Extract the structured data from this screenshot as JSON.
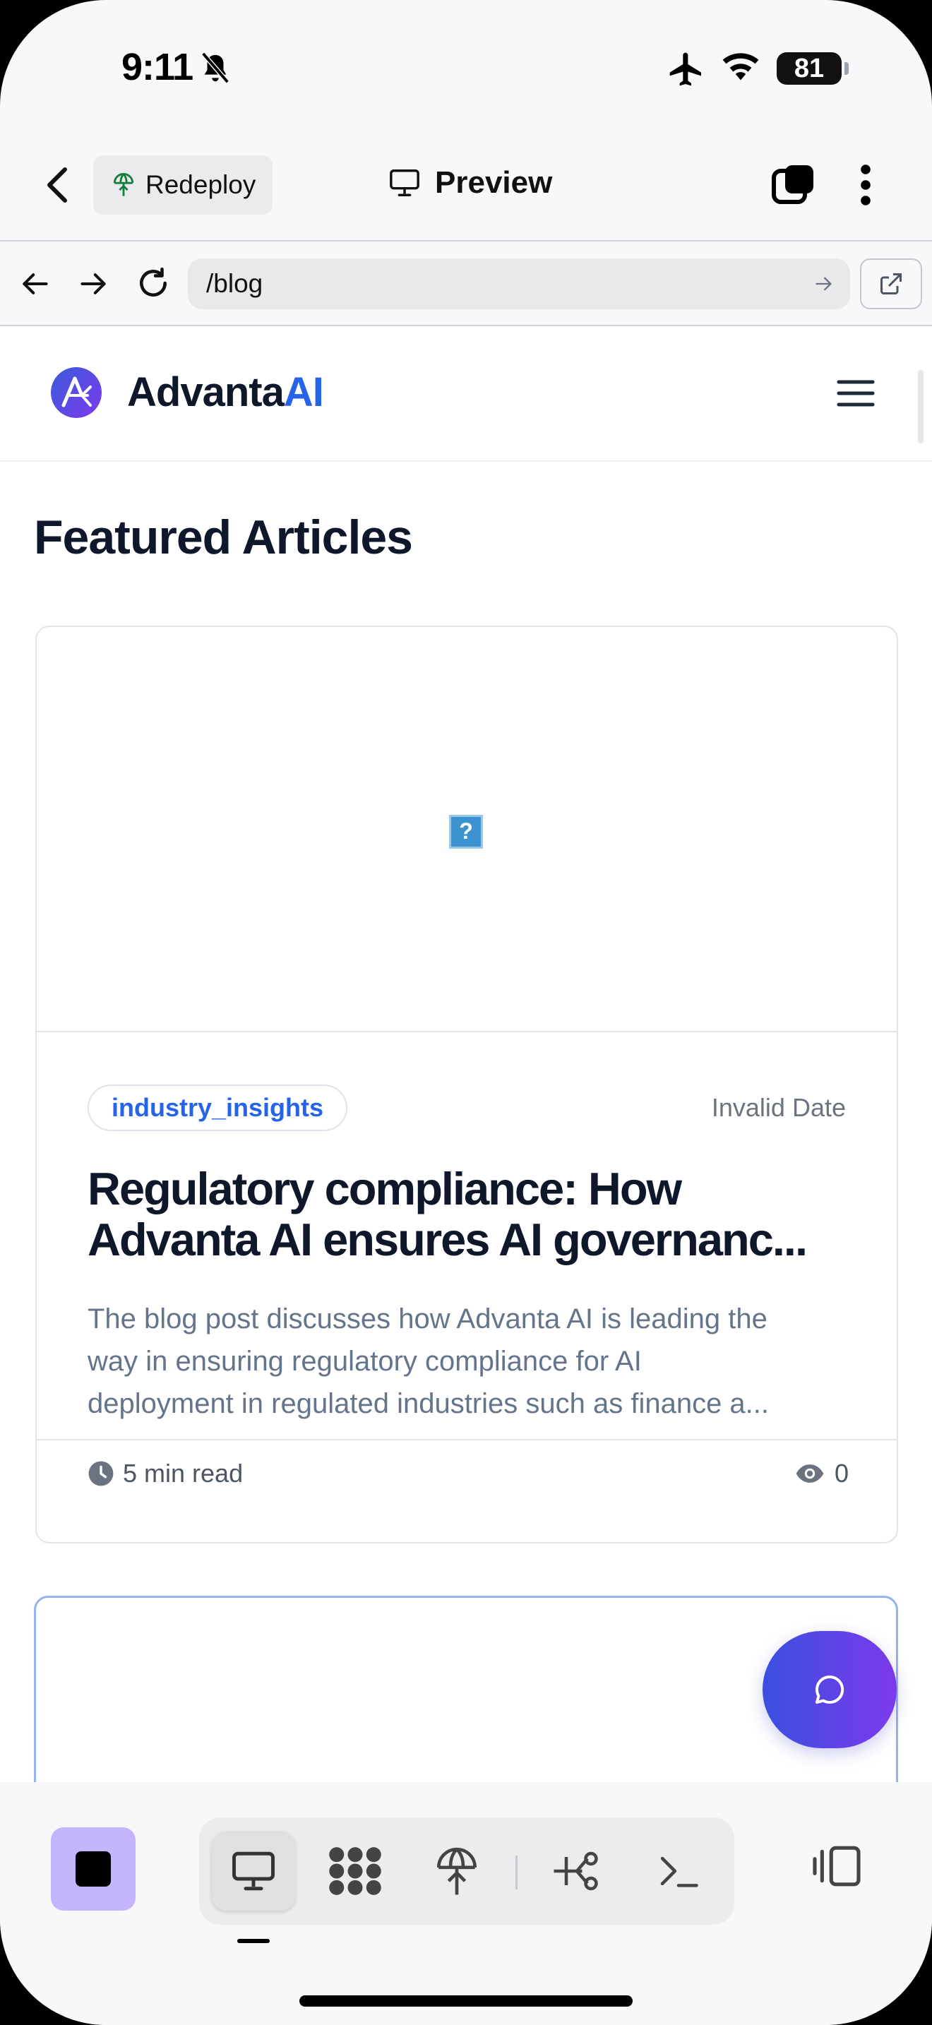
{
  "status_bar": {
    "time": "9:11",
    "battery": "81"
  },
  "app_bar": {
    "redeploy_label": "Redeploy",
    "title": "Preview"
  },
  "url_bar": {
    "url": "/blog"
  },
  "site": {
    "brand_main": "Advanta",
    "brand_accent": "AI"
  },
  "page": {
    "section_title": "Featured Articles"
  },
  "article": {
    "category": "industry_insights",
    "date": "Invalid Date",
    "title_lines": [
      "Regulatory compliance: How",
      "Advanta AI ensures AI governanc..."
    ],
    "excerpt_lines": [
      "The blog post discusses how Advanta AI is leading the",
      "way in ensuring regulatory compliance for AI",
      "deployment in regulated industries such as finance a..."
    ],
    "read_time": "5 min read",
    "views": "0",
    "image_placeholder": "?"
  },
  "colors": {
    "accent": "#2563eb",
    "fab_gradient_start": "#3b4fe0",
    "fab_gradient_end": "#7c3aed",
    "stop_button": "#c4b5fd"
  },
  "icons": {
    "status": [
      "bell-slash-icon",
      "airplane-icon",
      "wifi-icon"
    ],
    "app_bar": [
      "chevron-left-icon",
      "deploy-globe-icon",
      "monitor-icon",
      "tabs-icon",
      "more-vertical-icon"
    ],
    "url_bar": [
      "arrow-left-icon",
      "arrow-right-icon",
      "reload-icon",
      "go-arrow-icon",
      "external-link-icon"
    ],
    "toolbar": [
      "stop-icon",
      "preview-monitor-icon",
      "apps-grid-icon",
      "deploy-icon",
      "integrations-icon",
      "terminal-icon",
      "split-view-icon"
    ]
  }
}
